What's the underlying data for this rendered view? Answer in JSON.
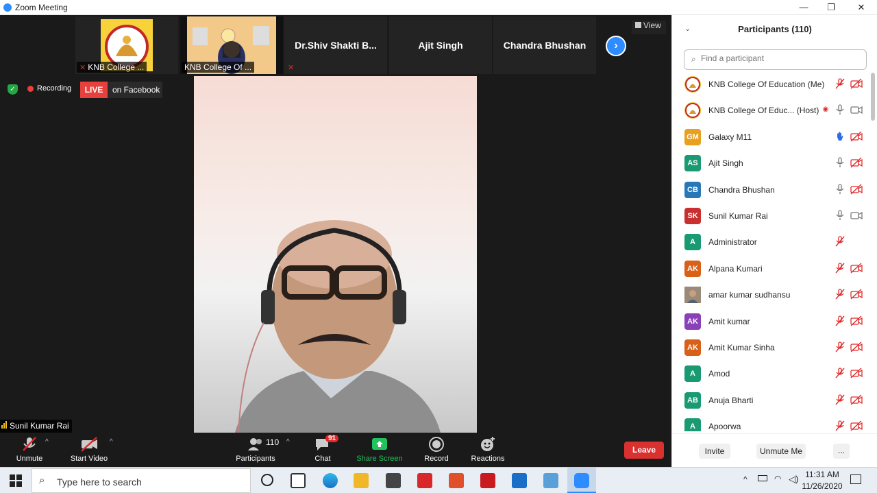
{
  "window": {
    "title": "Zoom Meeting"
  },
  "strip": {
    "tile1_label": "KNB College ...",
    "tile2_label": "KNB College Of ...",
    "tile3_name": "Dr.Shiv  Shakti  B...",
    "tile4_name": "Ajit Singh",
    "tile5_name": "Chandra Bhushan",
    "view_label": "View"
  },
  "status": {
    "recording": "Recording",
    "live": "LIVE",
    "facebook": "on Facebook"
  },
  "active_speaker": "Sunil Kumar Rai",
  "toolbar": {
    "unmute": "Unmute",
    "start_video": "Start Video",
    "participants": "Participants",
    "participants_count": "110",
    "chat": "Chat",
    "chat_badge": "91",
    "share_screen": "Share Screen",
    "record": "Record",
    "reactions": "Reactions",
    "leave": "Leave"
  },
  "panel": {
    "title": "Participants (110)",
    "search_placeholder": "Find a participant",
    "invite": "Invite",
    "unmute_me": "Unmute Me",
    "more": "...",
    "participants": [
      {
        "initials": "",
        "name": "KNB College Of Education (Me)",
        "color": "#f0c020",
        "mic": "off",
        "video": "off",
        "logo": true
      },
      {
        "initials": "",
        "name": "KNB College Of Educ... (Host)",
        "color": "#f0c020",
        "mic": "on",
        "video": "on",
        "logo": true,
        "rec": true
      },
      {
        "initials": "GM",
        "name": "Galaxy M11",
        "color": "#e8a020",
        "mic": "hand",
        "video": "off"
      },
      {
        "initials": "AS",
        "name": "Ajit Singh",
        "color": "#1a9a72",
        "mic": "on",
        "video": "off"
      },
      {
        "initials": "CB",
        "name": "Chandra Bhushan",
        "color": "#2878b8",
        "mic": "on",
        "video": "off"
      },
      {
        "initials": "SK",
        "name": "Sunil Kumar Rai",
        "color": "#c83030",
        "mic": "on",
        "video": "on"
      },
      {
        "initials": "A",
        "name": "Administrator",
        "color": "#1a9a72",
        "mic": "off",
        "video": "none"
      },
      {
        "initials": "AK",
        "name": "Alpana Kumari",
        "color": "#d86018",
        "mic": "off",
        "video": "off"
      },
      {
        "initials": "",
        "name": "amar kumar sudhansu",
        "color": "#8a7060",
        "mic": "off",
        "video": "off",
        "photo": true
      },
      {
        "initials": "AK",
        "name": "Amit kumar",
        "color": "#8a40b8",
        "mic": "off",
        "video": "off"
      },
      {
        "initials": "AK",
        "name": "Amit Kumar Sinha",
        "color": "#d86018",
        "mic": "off",
        "video": "off"
      },
      {
        "initials": "A",
        "name": "Amod",
        "color": "#1a9a72",
        "mic": "off",
        "video": "off"
      },
      {
        "initials": "AB",
        "name": "Anuja Bharti",
        "color": "#1a9a72",
        "mic": "off",
        "video": "off"
      },
      {
        "initials": "A",
        "name": "Apoorwa",
        "color": "#1a9a72",
        "mic": "off",
        "video": "off"
      }
    ]
  },
  "taskbar": {
    "search_placeholder": "Type here to search",
    "time": "11:31 AM",
    "date": "11/26/2020"
  },
  "colors": {
    "live_red": "#e8403c",
    "leave_red": "#d93030",
    "share_green": "#22c35e",
    "zoom_blue": "#2d8cff",
    "mute_red": "#e02828"
  }
}
